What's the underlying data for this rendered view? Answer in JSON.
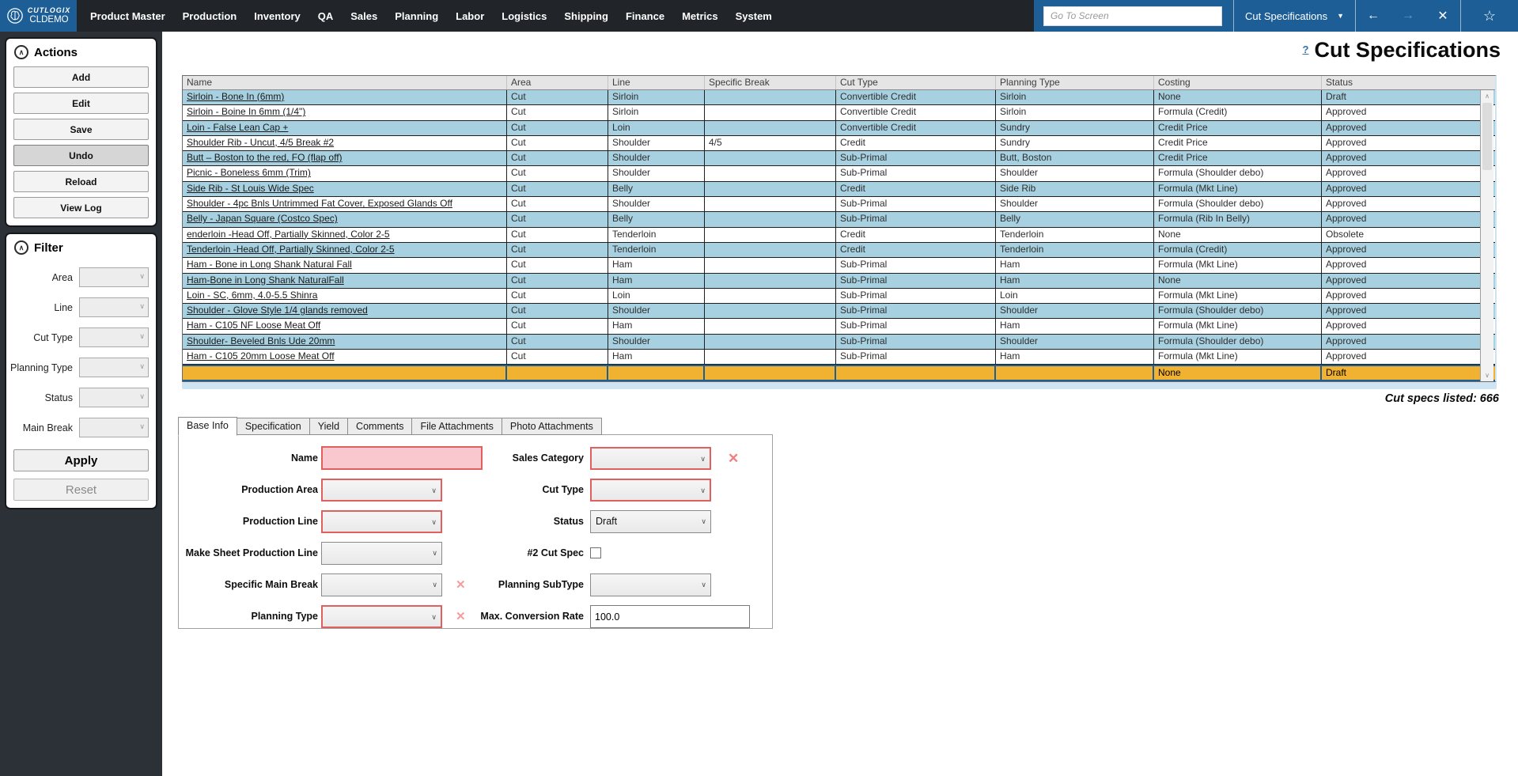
{
  "topbar": {
    "brand": "CUTLOGIX",
    "environment": "CLDEMO",
    "menu": [
      "Product Master",
      "Production",
      "Inventory",
      "QA",
      "Sales",
      "Planning",
      "Labor",
      "Logistics",
      "Shipping",
      "Finance",
      "Metrics",
      "System"
    ],
    "goto": {
      "placeholder": "Go To Screen"
    },
    "screen_select": {
      "value": "Cut Specifications",
      "caret": "▼"
    },
    "nav": {
      "back": "←",
      "forward": "→",
      "close": "✕",
      "favorite": "☆"
    }
  },
  "actions_panel": {
    "title": "Actions",
    "buttons": [
      "Add",
      "Edit",
      "Save",
      "Undo",
      "Reload",
      "View Log"
    ],
    "pressed": "Undo",
    "collapse_glyph": "∧"
  },
  "filter_panel": {
    "title": "Filter",
    "fields": [
      "Area",
      "Line",
      "Cut Type",
      "Planning Type",
      "Status",
      "Main Break"
    ],
    "apply_label": "Apply",
    "reset_label": "Reset",
    "collapse_glyph": "∧"
  },
  "page": {
    "help_link": "?",
    "title": "Cut Specifications",
    "count_text": "Cut specs listed: 666"
  },
  "grid": {
    "columns": [
      "Name",
      "Area",
      "Line",
      "Specific Break",
      "Cut Type",
      "Planning Type",
      "Costing",
      "Status"
    ],
    "rows": [
      [
        "Sirloin - Bone In (6mm)",
        "Cut",
        "Sirloin",
        "",
        "Convertible Credit",
        "Sirloin",
        "None",
        "Draft"
      ],
      [
        "Sirloin - Boine In 6mm (1/4\")",
        "Cut",
        "Sirloin",
        "",
        "Convertible Credit",
        "Sirloin",
        "Formula (Credit)",
        "Approved"
      ],
      [
        "Loin - False Lean Cap +",
        "Cut",
        "Loin",
        "",
        "Convertible Credit",
        "Sundry",
        "Credit Price",
        "Approved"
      ],
      [
        "Shoulder Rib - Uncut, 4/5 Break #2",
        "Cut",
        "Shoulder",
        "4/5",
        "Credit",
        "Sundry",
        "Credit Price",
        "Approved"
      ],
      [
        "Butt – Boston to the red, FO (flap off)",
        "Cut",
        "Shoulder",
        "",
        "Sub-Primal",
        "Butt, Boston",
        "Credit Price",
        "Approved"
      ],
      [
        "Picnic - Boneless 6mm (Trim)",
        "Cut",
        "Shoulder",
        "",
        "Sub-Primal",
        "Shoulder",
        "Formula (Shoulder debo)",
        "Approved"
      ],
      [
        "Side Rib - St Louis Wide Spec",
        "Cut",
        "Belly",
        "",
        "Credit",
        "Side Rib",
        "Formula (Mkt Line)",
        "Approved"
      ],
      [
        "Shoulder - 4pc Bnls Untrimmed Fat Cover, Exposed Glands Off",
        "Cut",
        "Shoulder",
        "",
        "Sub-Primal",
        "Shoulder",
        "Formula (Shoulder debo)",
        "Approved"
      ],
      [
        "Belly - Japan Square (Costco Spec)",
        "Cut",
        "Belly",
        "",
        "Sub-Primal",
        "Belly",
        "Formula (Rib In Belly)",
        "Approved"
      ],
      [
        "enderloin -Head Off, Partially Skinned, Color 2-5",
        "Cut",
        "Tenderloin",
        "",
        "Credit",
        "Tenderloin",
        "None",
        "Obsolete"
      ],
      [
        "Tenderloin -Head Off, Partially Skinned, Color 2-5",
        "Cut",
        "Tenderloin",
        "",
        "Credit",
        "Tenderloin",
        "Formula (Credit)",
        "Approved"
      ],
      [
        "Ham - Bone in Long Shank Natural Fall",
        "Cut",
        "Ham",
        "",
        "Sub-Primal",
        "Ham",
        "Formula (Mkt Line)",
        "Approved"
      ],
      [
        "Ham-Bone in Long Shank NaturalFall",
        "Cut",
        "Ham",
        "",
        "Sub-Primal",
        "Ham",
        "None",
        "Approved"
      ],
      [
        "Loin - SC, 6mm, 4.0-5.5 Shinra",
        "Cut",
        "Loin",
        "",
        "Sub-Primal",
        "Loin",
        "Formula (Mkt Line)",
        "Approved"
      ],
      [
        "Shoulder - Glove Style 1/4 glands removed",
        "Cut",
        "Shoulder",
        "",
        "Sub-Primal",
        "Shoulder",
        "Formula (Shoulder debo)",
        "Approved"
      ],
      [
        "Ham - C105 NF  Loose Meat Off",
        "Cut",
        "Ham",
        "",
        "Sub-Primal",
        "Ham",
        "Formula (Mkt Line)",
        "Approved"
      ],
      [
        "Shoulder- Beveled Bnls Ude 20mm",
        "Cut",
        "Shoulder",
        "",
        "Sub-Primal",
        "Shoulder",
        "Formula (Shoulder debo)",
        "Approved"
      ],
      [
        "Ham - C105 20mm Loose Meat Off",
        "Cut",
        "Ham",
        "",
        "Sub-Primal",
        "Ham",
        "Formula (Mkt Line)",
        "Approved"
      ]
    ],
    "new_row": [
      "",
      "",
      "",
      "",
      "",
      "",
      "None",
      "Draft"
    ]
  },
  "detail": {
    "tabs": [
      "Base Info",
      "Specification",
      "Yield",
      "Comments",
      "File Attachments",
      "Photo Attachments"
    ],
    "active_tab": "Base Info",
    "form": {
      "labels": {
        "name": "Name",
        "production_area": "Production Area",
        "production_line": "Production Line",
        "make_sheet_production_line": "Make Sheet Production Line",
        "specific_main_break": "Specific Main Break",
        "planning_type": "Planning Type",
        "sales_category": "Sales Category",
        "cut_type": "Cut Type",
        "status": "Status",
        "cut_spec_2": "#2 Cut Spec",
        "planning_subtype": "Planning SubType",
        "max_conversion_rate": "Max. Conversion Rate"
      },
      "values": {
        "status": "Draft",
        "max_conversion_rate": "100.0"
      }
    }
  },
  "colors": {
    "accent_blue": "#1d5e96",
    "topbar_dark": "#212529",
    "sidebar_dark": "#2c3037",
    "row_blue": "#a7d1e0",
    "selected_orange": "#f1b231",
    "error_red": "#e05f5f"
  }
}
